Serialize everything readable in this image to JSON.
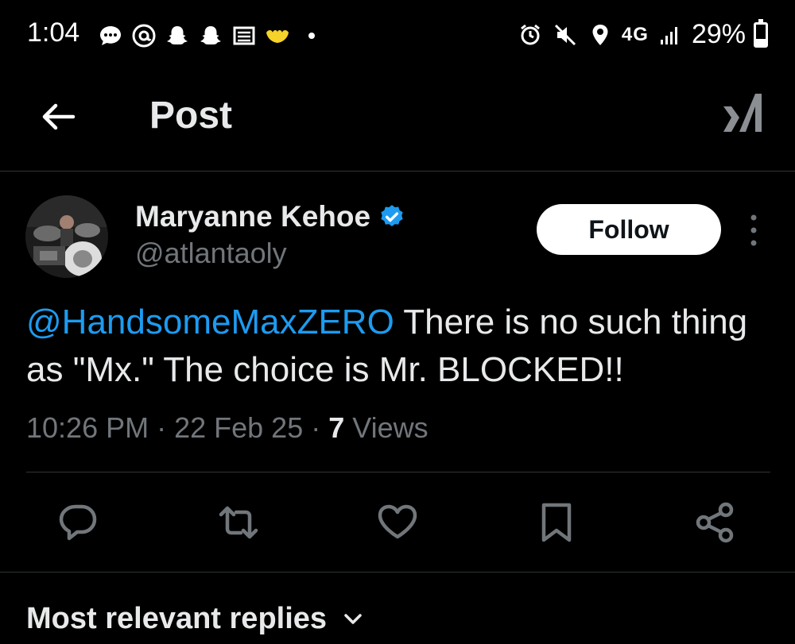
{
  "status_bar": {
    "time": "1:04",
    "network": "4G",
    "network_sub": "LTE",
    "battery": "29%",
    "battery_level": 0.29,
    "left_icons": [
      "messages-icon",
      "threads-icon",
      "snapchat-icon",
      "snapchat-icon",
      "news-icon",
      "wanna-icon"
    ],
    "right_icons": [
      "alarm-icon",
      "mute-icon",
      "location-icon",
      "signal-icon",
      "battery-icon"
    ]
  },
  "header": {
    "title": "Post",
    "back_icon": "arrow-left-icon",
    "grok_icon": "grok-icon"
  },
  "post": {
    "author_name": "Maryanne Kehoe",
    "author_handle": "@atlantaoly",
    "verified": true,
    "follow_label": "Follow",
    "mention": "@HandsomeMaxZERO",
    "text": " There is no such thing as \"Mx.\" The choice is Mr. BLOCKED!!",
    "time": "10:26 PM",
    "date": "22 Feb 25",
    "views_count": "7",
    "views_label": "Views",
    "separator": " · "
  },
  "actions": [
    "reply-icon",
    "repost-icon",
    "like-icon",
    "bookmark-icon",
    "share-icon"
  ],
  "replies": {
    "sort_label": "Most relevant replies"
  },
  "colors": {
    "background": "#000000",
    "text": "#e7e9ea",
    "secondary": "#71767b",
    "accent": "#1d9bf0",
    "divider": "#2f3336"
  }
}
